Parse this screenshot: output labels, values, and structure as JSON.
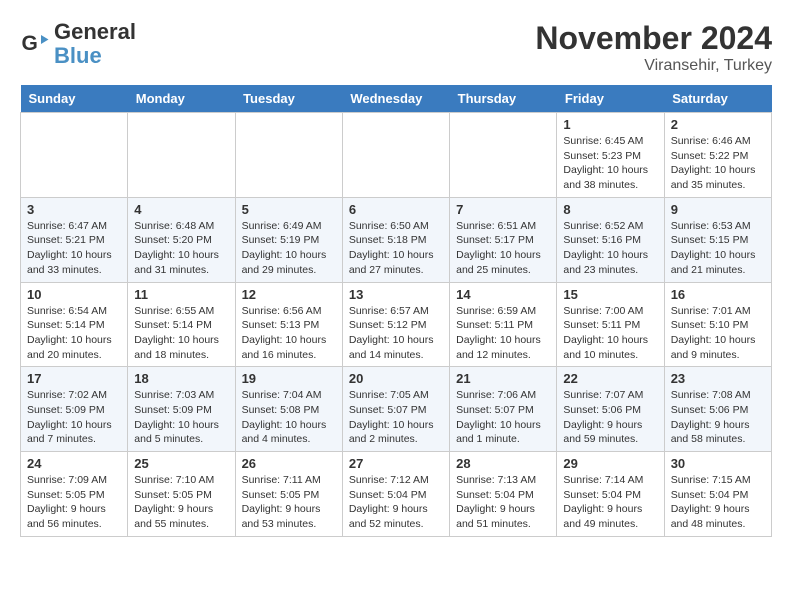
{
  "header": {
    "logo_line1": "General",
    "logo_line2": "Blue",
    "month": "November 2024",
    "location": "Viransehir, Turkey"
  },
  "days_of_week": [
    "Sunday",
    "Monday",
    "Tuesday",
    "Wednesday",
    "Thursday",
    "Friday",
    "Saturday"
  ],
  "weeks": [
    [
      {
        "day": "",
        "info": ""
      },
      {
        "day": "",
        "info": ""
      },
      {
        "day": "",
        "info": ""
      },
      {
        "day": "",
        "info": ""
      },
      {
        "day": "",
        "info": ""
      },
      {
        "day": "1",
        "info": "Sunrise: 6:45 AM\nSunset: 5:23 PM\nDaylight: 10 hours and 38 minutes."
      },
      {
        "day": "2",
        "info": "Sunrise: 6:46 AM\nSunset: 5:22 PM\nDaylight: 10 hours and 35 minutes."
      }
    ],
    [
      {
        "day": "3",
        "info": "Sunrise: 6:47 AM\nSunset: 5:21 PM\nDaylight: 10 hours and 33 minutes."
      },
      {
        "day": "4",
        "info": "Sunrise: 6:48 AM\nSunset: 5:20 PM\nDaylight: 10 hours and 31 minutes."
      },
      {
        "day": "5",
        "info": "Sunrise: 6:49 AM\nSunset: 5:19 PM\nDaylight: 10 hours and 29 minutes."
      },
      {
        "day": "6",
        "info": "Sunrise: 6:50 AM\nSunset: 5:18 PM\nDaylight: 10 hours and 27 minutes."
      },
      {
        "day": "7",
        "info": "Sunrise: 6:51 AM\nSunset: 5:17 PM\nDaylight: 10 hours and 25 minutes."
      },
      {
        "day": "8",
        "info": "Sunrise: 6:52 AM\nSunset: 5:16 PM\nDaylight: 10 hours and 23 minutes."
      },
      {
        "day": "9",
        "info": "Sunrise: 6:53 AM\nSunset: 5:15 PM\nDaylight: 10 hours and 21 minutes."
      }
    ],
    [
      {
        "day": "10",
        "info": "Sunrise: 6:54 AM\nSunset: 5:14 PM\nDaylight: 10 hours and 20 minutes."
      },
      {
        "day": "11",
        "info": "Sunrise: 6:55 AM\nSunset: 5:14 PM\nDaylight: 10 hours and 18 minutes."
      },
      {
        "day": "12",
        "info": "Sunrise: 6:56 AM\nSunset: 5:13 PM\nDaylight: 10 hours and 16 minutes."
      },
      {
        "day": "13",
        "info": "Sunrise: 6:57 AM\nSunset: 5:12 PM\nDaylight: 10 hours and 14 minutes."
      },
      {
        "day": "14",
        "info": "Sunrise: 6:59 AM\nSunset: 5:11 PM\nDaylight: 10 hours and 12 minutes."
      },
      {
        "day": "15",
        "info": "Sunrise: 7:00 AM\nSunset: 5:11 PM\nDaylight: 10 hours and 10 minutes."
      },
      {
        "day": "16",
        "info": "Sunrise: 7:01 AM\nSunset: 5:10 PM\nDaylight: 10 hours and 9 minutes."
      }
    ],
    [
      {
        "day": "17",
        "info": "Sunrise: 7:02 AM\nSunset: 5:09 PM\nDaylight: 10 hours and 7 minutes."
      },
      {
        "day": "18",
        "info": "Sunrise: 7:03 AM\nSunset: 5:09 PM\nDaylight: 10 hours and 5 minutes."
      },
      {
        "day": "19",
        "info": "Sunrise: 7:04 AM\nSunset: 5:08 PM\nDaylight: 10 hours and 4 minutes."
      },
      {
        "day": "20",
        "info": "Sunrise: 7:05 AM\nSunset: 5:07 PM\nDaylight: 10 hours and 2 minutes."
      },
      {
        "day": "21",
        "info": "Sunrise: 7:06 AM\nSunset: 5:07 PM\nDaylight: 10 hours and 1 minute."
      },
      {
        "day": "22",
        "info": "Sunrise: 7:07 AM\nSunset: 5:06 PM\nDaylight: 9 hours and 59 minutes."
      },
      {
        "day": "23",
        "info": "Sunrise: 7:08 AM\nSunset: 5:06 PM\nDaylight: 9 hours and 58 minutes."
      }
    ],
    [
      {
        "day": "24",
        "info": "Sunrise: 7:09 AM\nSunset: 5:05 PM\nDaylight: 9 hours and 56 minutes."
      },
      {
        "day": "25",
        "info": "Sunrise: 7:10 AM\nSunset: 5:05 PM\nDaylight: 9 hours and 55 minutes."
      },
      {
        "day": "26",
        "info": "Sunrise: 7:11 AM\nSunset: 5:05 PM\nDaylight: 9 hours and 53 minutes."
      },
      {
        "day": "27",
        "info": "Sunrise: 7:12 AM\nSunset: 5:04 PM\nDaylight: 9 hours and 52 minutes."
      },
      {
        "day": "28",
        "info": "Sunrise: 7:13 AM\nSunset: 5:04 PM\nDaylight: 9 hours and 51 minutes."
      },
      {
        "day": "29",
        "info": "Sunrise: 7:14 AM\nSunset: 5:04 PM\nDaylight: 9 hours and 49 minutes."
      },
      {
        "day": "30",
        "info": "Sunrise: 7:15 AM\nSunset: 5:04 PM\nDaylight: 9 hours and 48 minutes."
      }
    ]
  ]
}
